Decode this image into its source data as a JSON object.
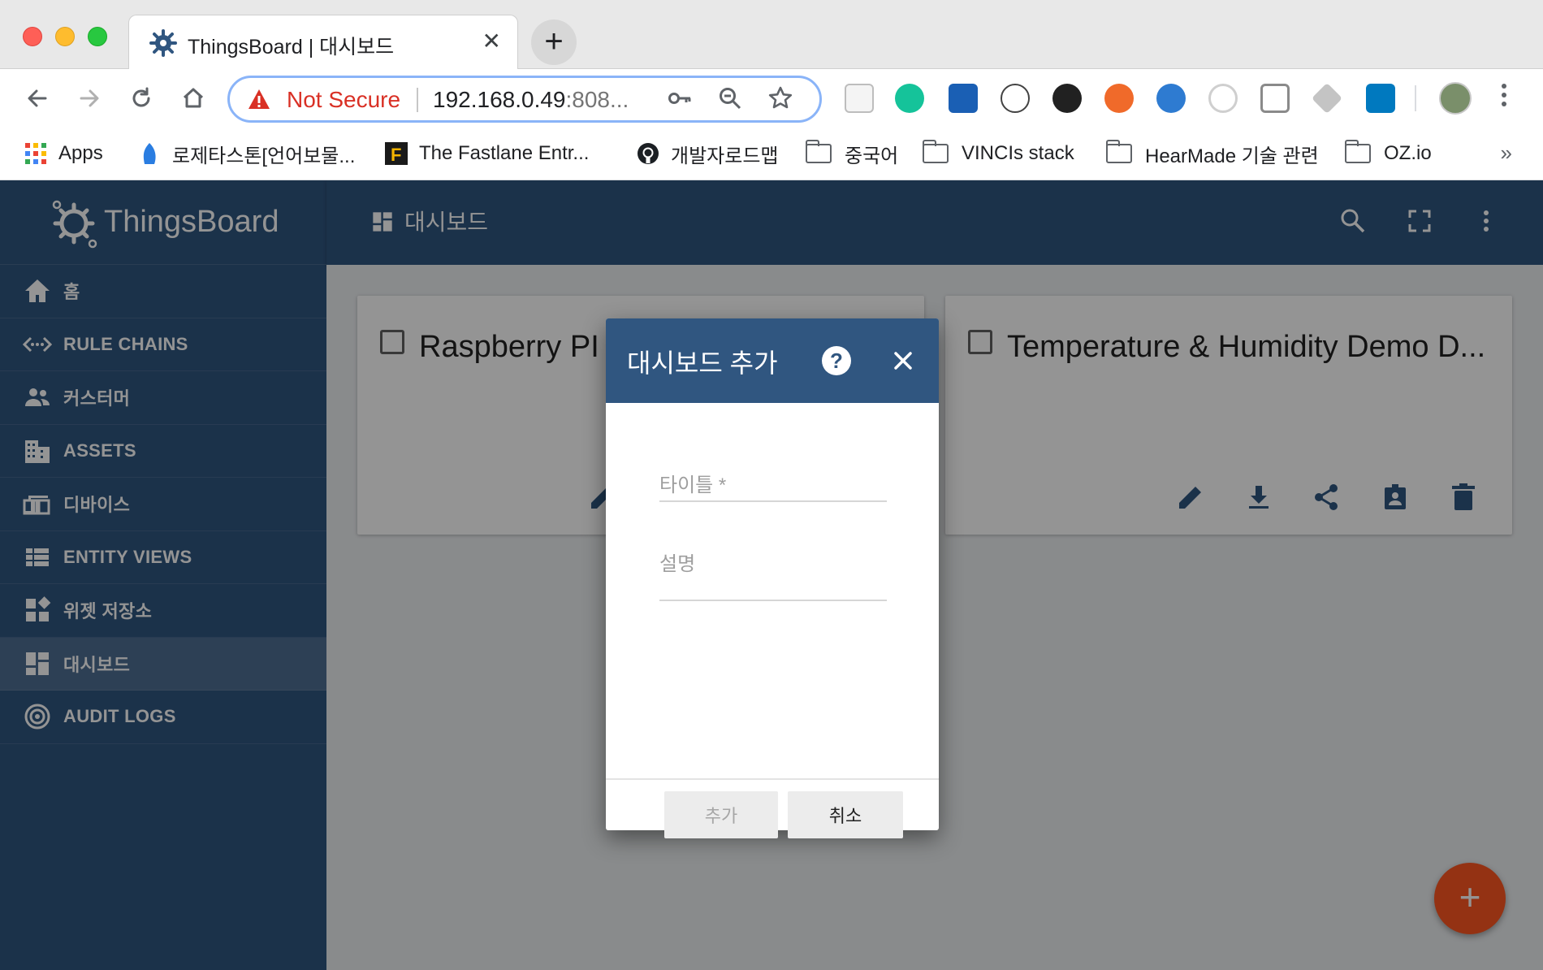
{
  "browser": {
    "tab": {
      "title": "ThingsBoard | 대시보드",
      "close": "✕"
    },
    "new_tab": "+",
    "omnibox": {
      "security_label": "Not Secure",
      "url": "192.168.0.49",
      "url_port": ":808..."
    },
    "bookmarks": [
      {
        "label": "Apps",
        "icon": "apps-grid-icon"
      },
      {
        "label": "로제타스톤[언어보물...",
        "icon": "rosetta-stone-icon"
      },
      {
        "label": "The Fastlane Entr...",
        "icon": "fastlane-icon"
      },
      {
        "label": "개발자로드맵",
        "icon": "github-icon"
      },
      {
        "label": "중국어",
        "icon": "folder-icon"
      },
      {
        "label": "VINCIs stack",
        "icon": "folder-icon"
      },
      {
        "label": "HearMade 기술 관련",
        "icon": "folder-icon"
      },
      {
        "label": "OZ.io",
        "icon": "folder-icon"
      }
    ],
    "bookmarks_overflow": "»"
  },
  "app": {
    "brand": "ThingsBoard",
    "menu": [
      {
        "label": "홈",
        "icon": "home-icon"
      },
      {
        "label": "RULE CHAINS",
        "icon": "rule-chains-icon"
      },
      {
        "label": "커스터머",
        "icon": "customers-icon"
      },
      {
        "label": "ASSETS",
        "icon": "assets-icon"
      },
      {
        "label": "디바이스",
        "icon": "devices-icon"
      },
      {
        "label": "ENTITY VIEWS",
        "icon": "entity-views-icon"
      },
      {
        "label": "위젯 저장소",
        "icon": "widgets-icon"
      },
      {
        "label": "대시보드",
        "icon": "dashboards-icon",
        "active": true
      },
      {
        "label": "AUDIT LOGS",
        "icon": "audit-logs-icon"
      }
    ],
    "topbar": {
      "title": "대시보드"
    },
    "cards": [
      {
        "title": "Raspberry PI C"
      },
      {
        "title": "Temperature & Humidity Demo D..."
      }
    ],
    "fab": "+"
  },
  "dialog": {
    "title": "대시보드 추가",
    "help": "?",
    "title_placeholder": "타이틀 *",
    "description_placeholder": "설명",
    "add_label": "추가",
    "cancel_label": "취소"
  },
  "colors": {
    "primary": "#305680",
    "accent": "#ff5722",
    "not_secure": "#d93025"
  }
}
